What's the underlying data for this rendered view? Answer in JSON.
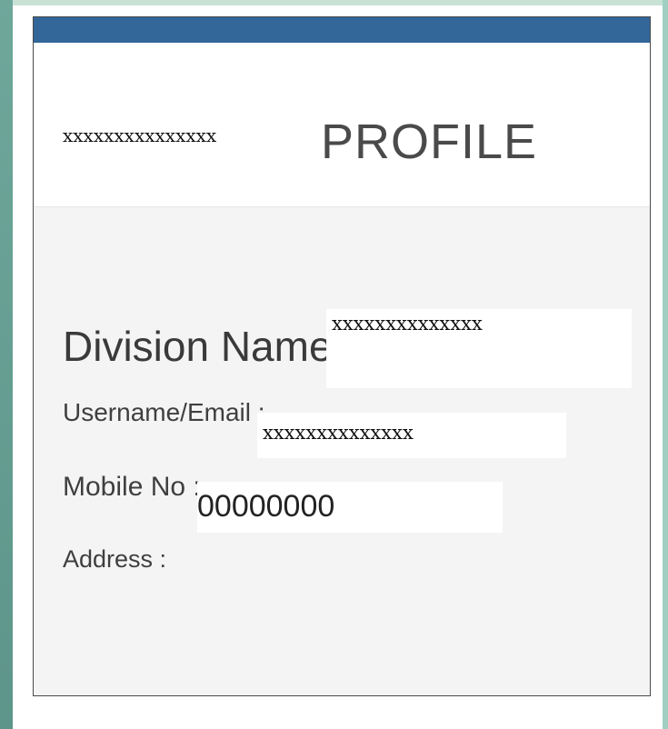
{
  "header": {
    "brand": "xxxxxxxxxxxxxxx",
    "title": "PROFILE"
  },
  "profile": {
    "division_label": "Division Name :",
    "division_value": "xxxxxxxxxxxxxx",
    "username_label": "Username/Email :",
    "username_value": "xxxxxxxxxxxxxx",
    "mobile_label": "Mobile No :",
    "mobile_value": "00000000",
    "address_label": "Address :"
  }
}
